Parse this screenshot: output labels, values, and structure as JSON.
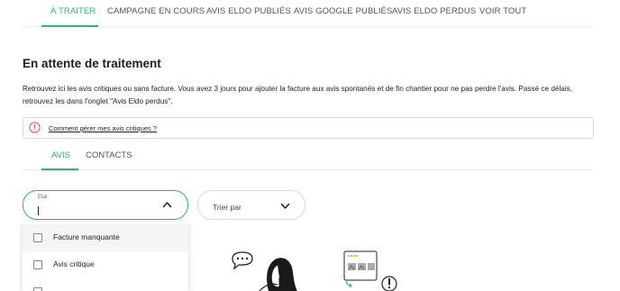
{
  "top_tabs": [
    {
      "label": "À TRAITER",
      "active": true
    },
    {
      "label": "CAMPAGNE EN COURS",
      "active": false
    },
    {
      "label": "AVIS ELDO PUBLIÉS",
      "active": false
    },
    {
      "label": "AVIS GOOGLE PUBLIÉS",
      "active": false
    },
    {
      "label": "AVIS ELDO PERDUS",
      "active": false
    },
    {
      "label": "VOIR TOUT",
      "active": false
    }
  ],
  "page": {
    "title": "En attente de traitement",
    "description": "Retrouvez ici les avis critiques ou sans facture. Vous avez 3 jours pour ajouter la facture aux avis spontanés et de fin chantier pour ne pas perdre l'avis. Passé ce délais, retrouvez les dans l'onglet \"Avis Eldo perdus\"."
  },
  "info": {
    "link": "Comment gérer mes avis critiques ?",
    "icon": "info-circle-icon"
  },
  "sub_tabs": [
    {
      "label": "AVIS",
      "active": true
    },
    {
      "label": "CONTACTS",
      "active": false
    }
  ],
  "filters": {
    "etat_label": "Etat",
    "etat_value": "",
    "tri_placeholder": "Trier par"
  },
  "dropdown_options": [
    {
      "label": "Facture manquante",
      "checked": false
    },
    {
      "label": "Avis critique",
      "checked": false
    },
    {
      "label": "",
      "checked": false
    }
  ],
  "colors": {
    "accent": "#2bb673",
    "info_icon": "#d9534f"
  }
}
